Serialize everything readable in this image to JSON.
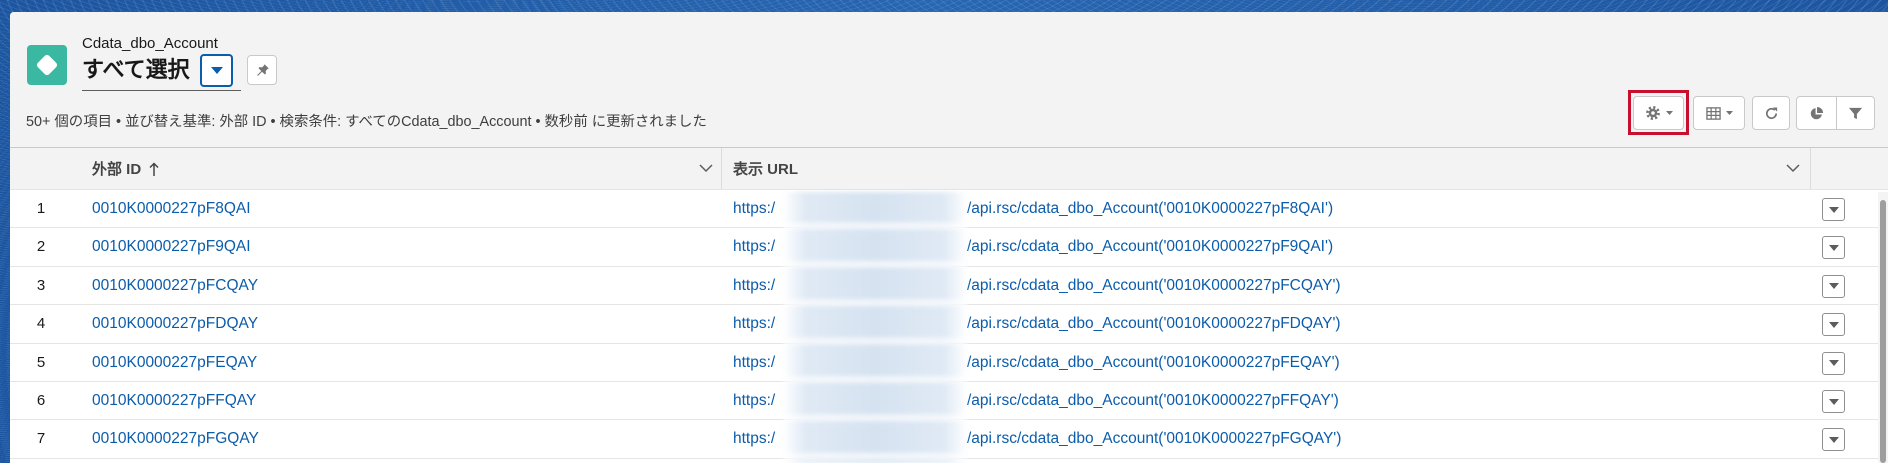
{
  "header": {
    "object_label": "Cdata_dbo_Account",
    "object_icon": "custom-object-diamond-icon",
    "list_view_name": "すべて選択",
    "list_view_switcher_icon": "caret-down-icon",
    "pin_icon": "pin-icon",
    "summary": "50+ 個の項目 • 並び替え基準: 外部 ID • 検索条件: すべてのCdata_dbo_Account • 数秒前 に更新されました"
  },
  "toolbar": {
    "buttons": [
      {
        "icon": "gear-icon",
        "has_menu": true,
        "highlighted": true
      },
      {
        "icon": "table-icon",
        "has_menu": true
      },
      {
        "icon": "refresh-icon"
      },
      {
        "icon": "pie-chart-icon"
      },
      {
        "icon": "filter-icon"
      }
    ]
  },
  "table": {
    "columns": [
      {
        "label": "外部 ID",
        "sort_icon": "arrow-up-icon",
        "menu_icon": "chevron-down-icon"
      },
      {
        "label": "表示 URL",
        "menu_icon": "chevron-down-icon"
      }
    ],
    "rows": [
      {
        "num": "1",
        "external_id": "0010K0000227pF8QAI",
        "url_prefix": "https:/",
        "url_suffix": "/api.rsc/cdata_dbo_Account('0010K0000227pF8QAI')"
      },
      {
        "num": "2",
        "external_id": "0010K0000227pF9QAI",
        "url_prefix": "https:/",
        "url_suffix": "/api.rsc/cdata_dbo_Account('0010K0000227pF9QAI')"
      },
      {
        "num": "3",
        "external_id": "0010K0000227pFCQAY",
        "url_prefix": "https:/",
        "url_suffix": "/api.rsc/cdata_dbo_Account('0010K0000227pFCQAY')"
      },
      {
        "num": "4",
        "external_id": "0010K0000227pFDQAY",
        "url_prefix": "https:/",
        "url_suffix": "/api.rsc/cdata_dbo_Account('0010K0000227pFDQAY')"
      },
      {
        "num": "5",
        "external_id": "0010K0000227pFEQAY",
        "url_prefix": "https:/",
        "url_suffix": "/api.rsc/cdata_dbo_Account('0010K0000227pFEQAY')"
      },
      {
        "num": "6",
        "external_id": "0010K0000227pFFQAY",
        "url_prefix": "https:/",
        "url_suffix": "/api.rsc/cdata_dbo_Account('0010K0000227pFFQAY')"
      },
      {
        "num": "7",
        "external_id": "0010K0000227pFGQAY",
        "url_prefix": "https:/",
        "url_suffix": "/api.rsc/cdata_dbo_Account('0010K0000227pFGQAY')"
      }
    ]
  },
  "colors": {
    "page_background": "#1f5aa6",
    "object_icon": "#3bb8a2",
    "link": "#0b5cab",
    "brand": "#0b5cab",
    "highlight": "#c8102e",
    "header_background": "#f3f3f3"
  }
}
